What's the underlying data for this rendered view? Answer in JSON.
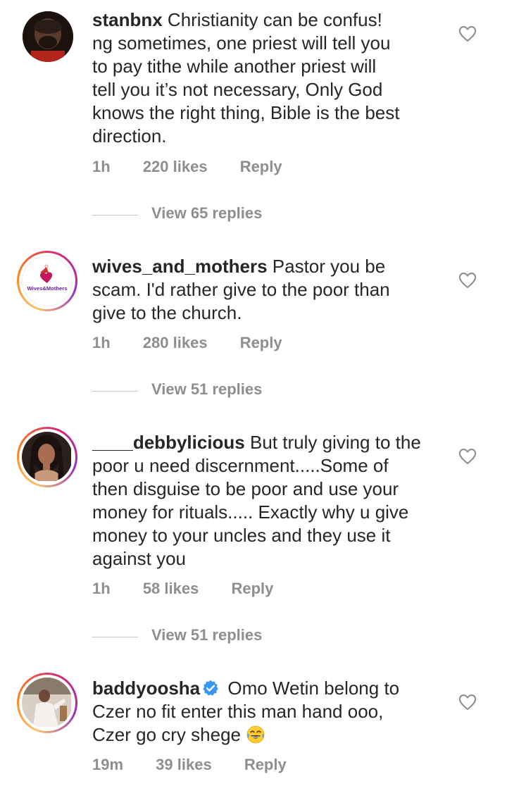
{
  "comments": [
    {
      "username": "stanbnx",
      "text": " Christianity can be confus!\nng sometimes, one priest will tell you\nto pay tithe while another priest will\ntell you it’s not necessary, Only God\nknows the right thing, Bible is the best\ndirection.",
      "time": "1h",
      "likes": "220 likes",
      "reply": "Reply",
      "view_replies": "View 65 replies"
    },
    {
      "username": "wives_and_mothers",
      "text": " Pastor you be\nscam. I'd rather give to the poor than\ngive to the church.",
      "time": "1h",
      "likes": "280 likes",
      "reply": "Reply",
      "view_replies": "View 51 replies",
      "avatar_logo_text": "Wives&Mothers"
    },
    {
      "username": "____debbylicious",
      "text": " But truly giving to the\npoor u need discernment.....Some of\nthen disguise to be poor and use your\nmoney for rituals..... Exactly why u give\nmoney to your uncles and they use it\nagainst you",
      "time": "1h",
      "likes": "58 likes",
      "reply": "Reply",
      "view_replies": "View 51 replies"
    },
    {
      "username": "baddyoosha",
      "text_before": " Omo Wetin belong to\nCzer no fit enter this man hand ooo,\nCzer go cry shege ",
      "time": "19m",
      "likes": "39 likes",
      "reply": "Reply"
    }
  ],
  "icons": {
    "like": "heart-outline-icon",
    "verified": "verified-badge-icon",
    "emoji": "tears-of-joy-emoji"
  },
  "colors": {
    "text": "#262626",
    "secondary": "#8e8e8e",
    "verified": "#3897f0",
    "story_ring": "#d62976"
  }
}
